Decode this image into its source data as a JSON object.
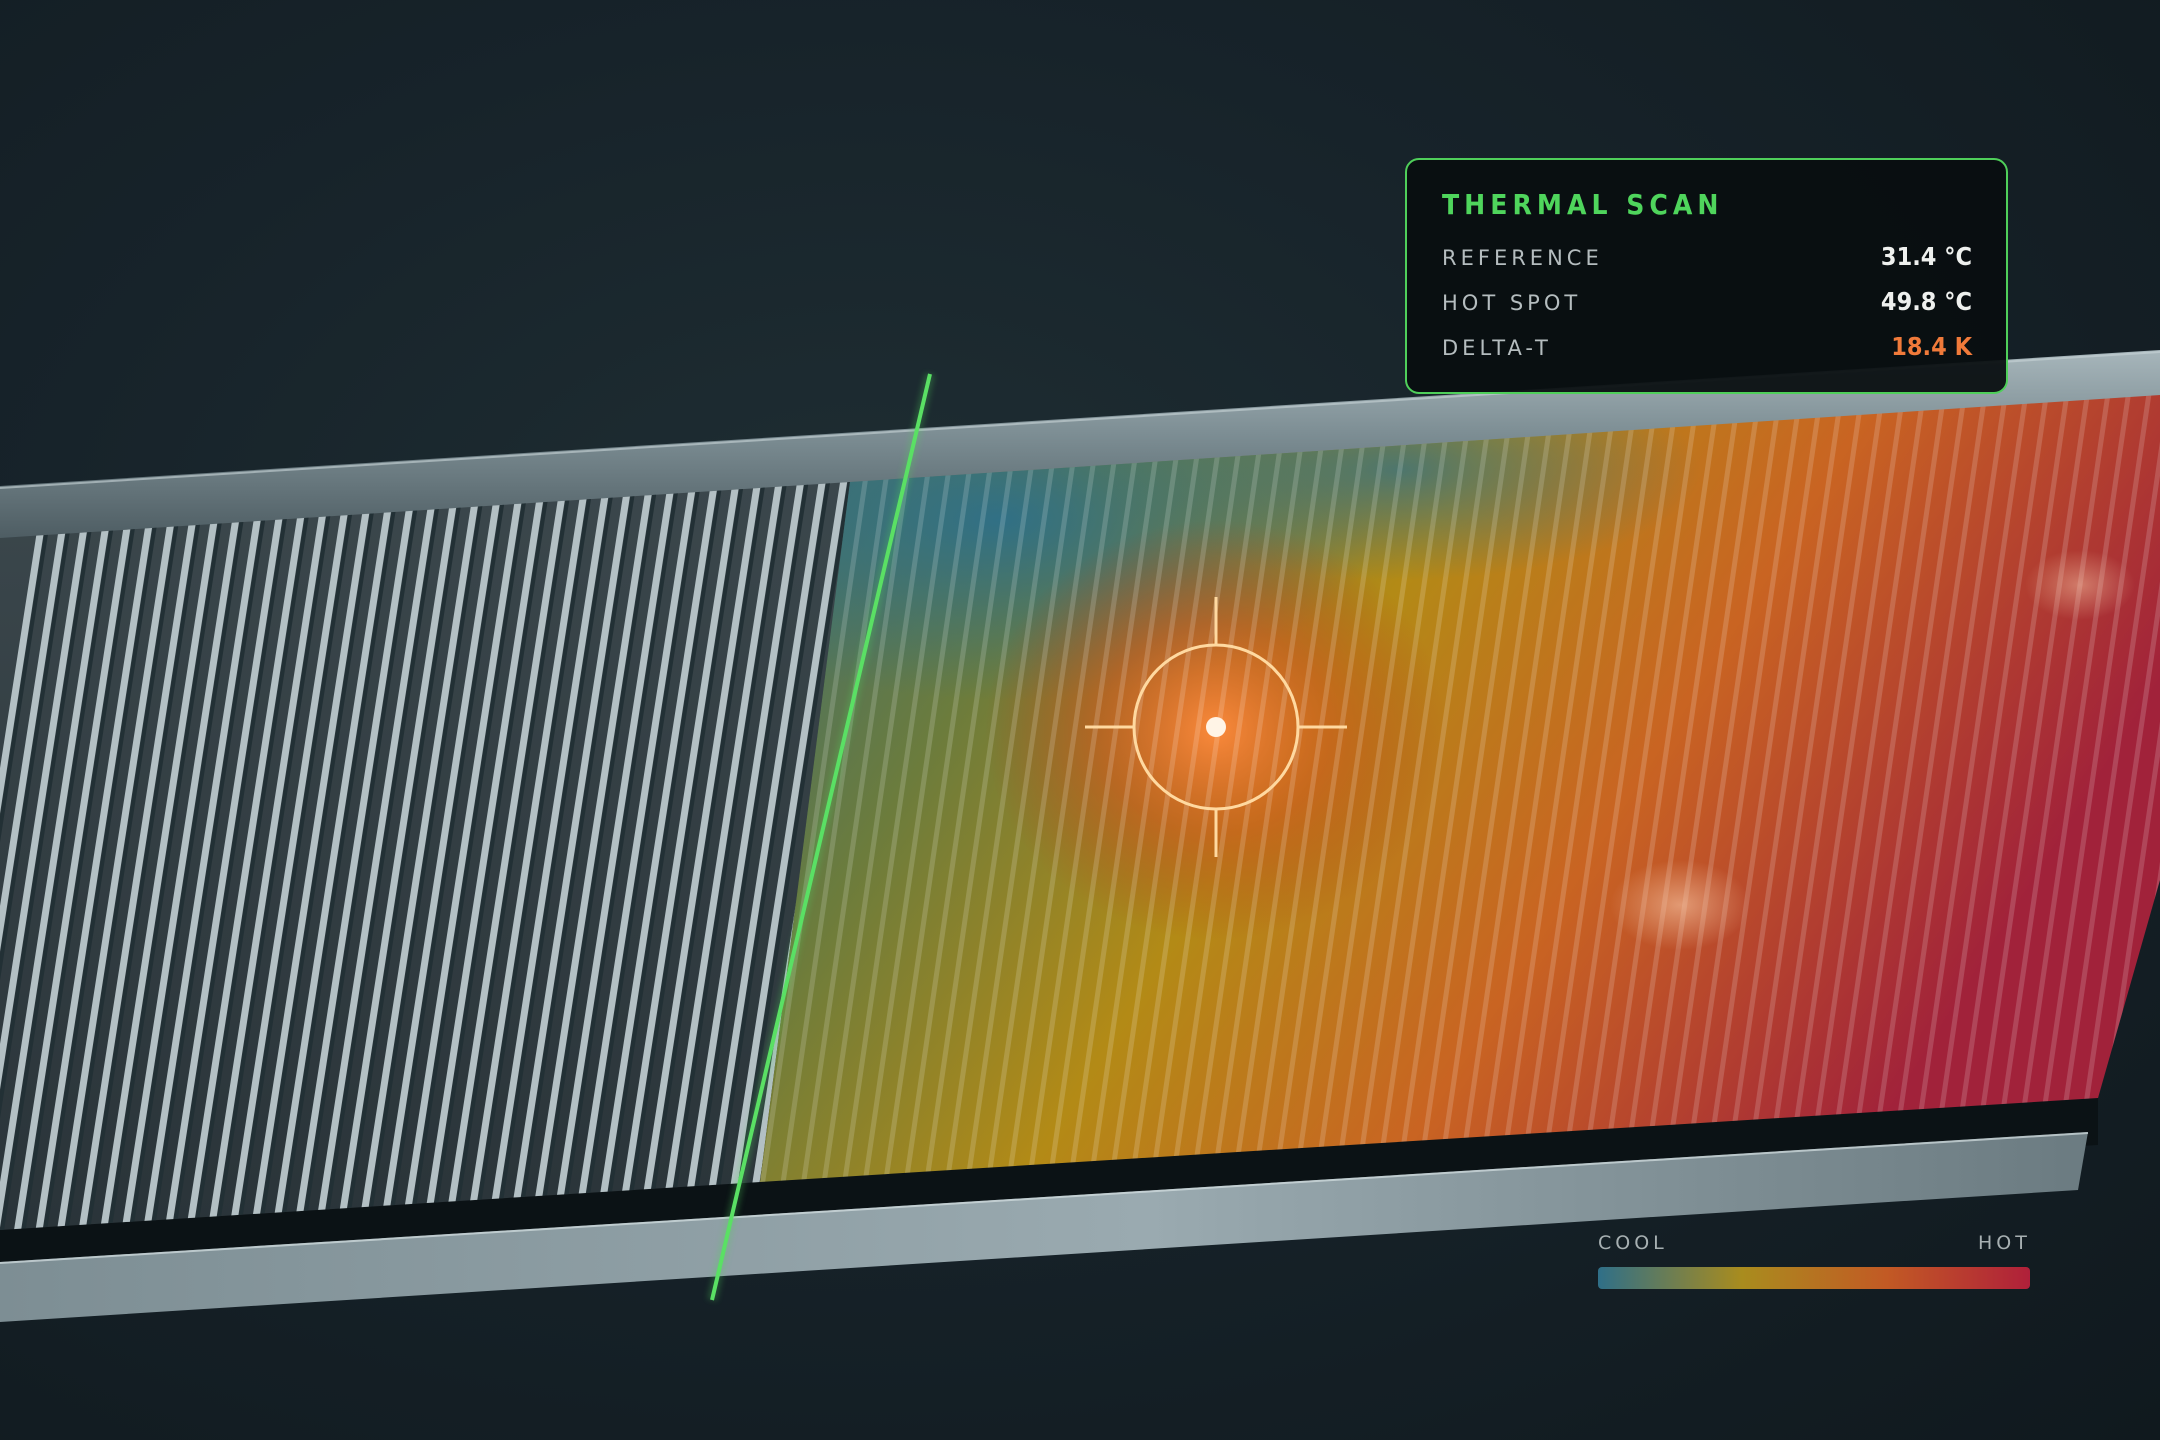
{
  "panel": {
    "title": "THERMAL SCAN",
    "rows": [
      {
        "label": "REFERENCE",
        "value": "31.4 °C"
      },
      {
        "label": "HOT SPOT",
        "value": "49.8 °C"
      },
      {
        "label": "DELTA-T",
        "value": "18.4 K"
      }
    ]
  },
  "legend": {
    "cool_label": "COOL",
    "hot_label": "HOT",
    "gradient_colors": [
      "#2f6f88",
      "#a98c1e",
      "#c25a24",
      "#b0203a"
    ]
  },
  "colors": {
    "accent_green": "#4fd55c",
    "accent_orange": "#f07a3a",
    "crosshair": "#ffd9a0"
  },
  "icons": {
    "target": "crosshair-icon"
  }
}
